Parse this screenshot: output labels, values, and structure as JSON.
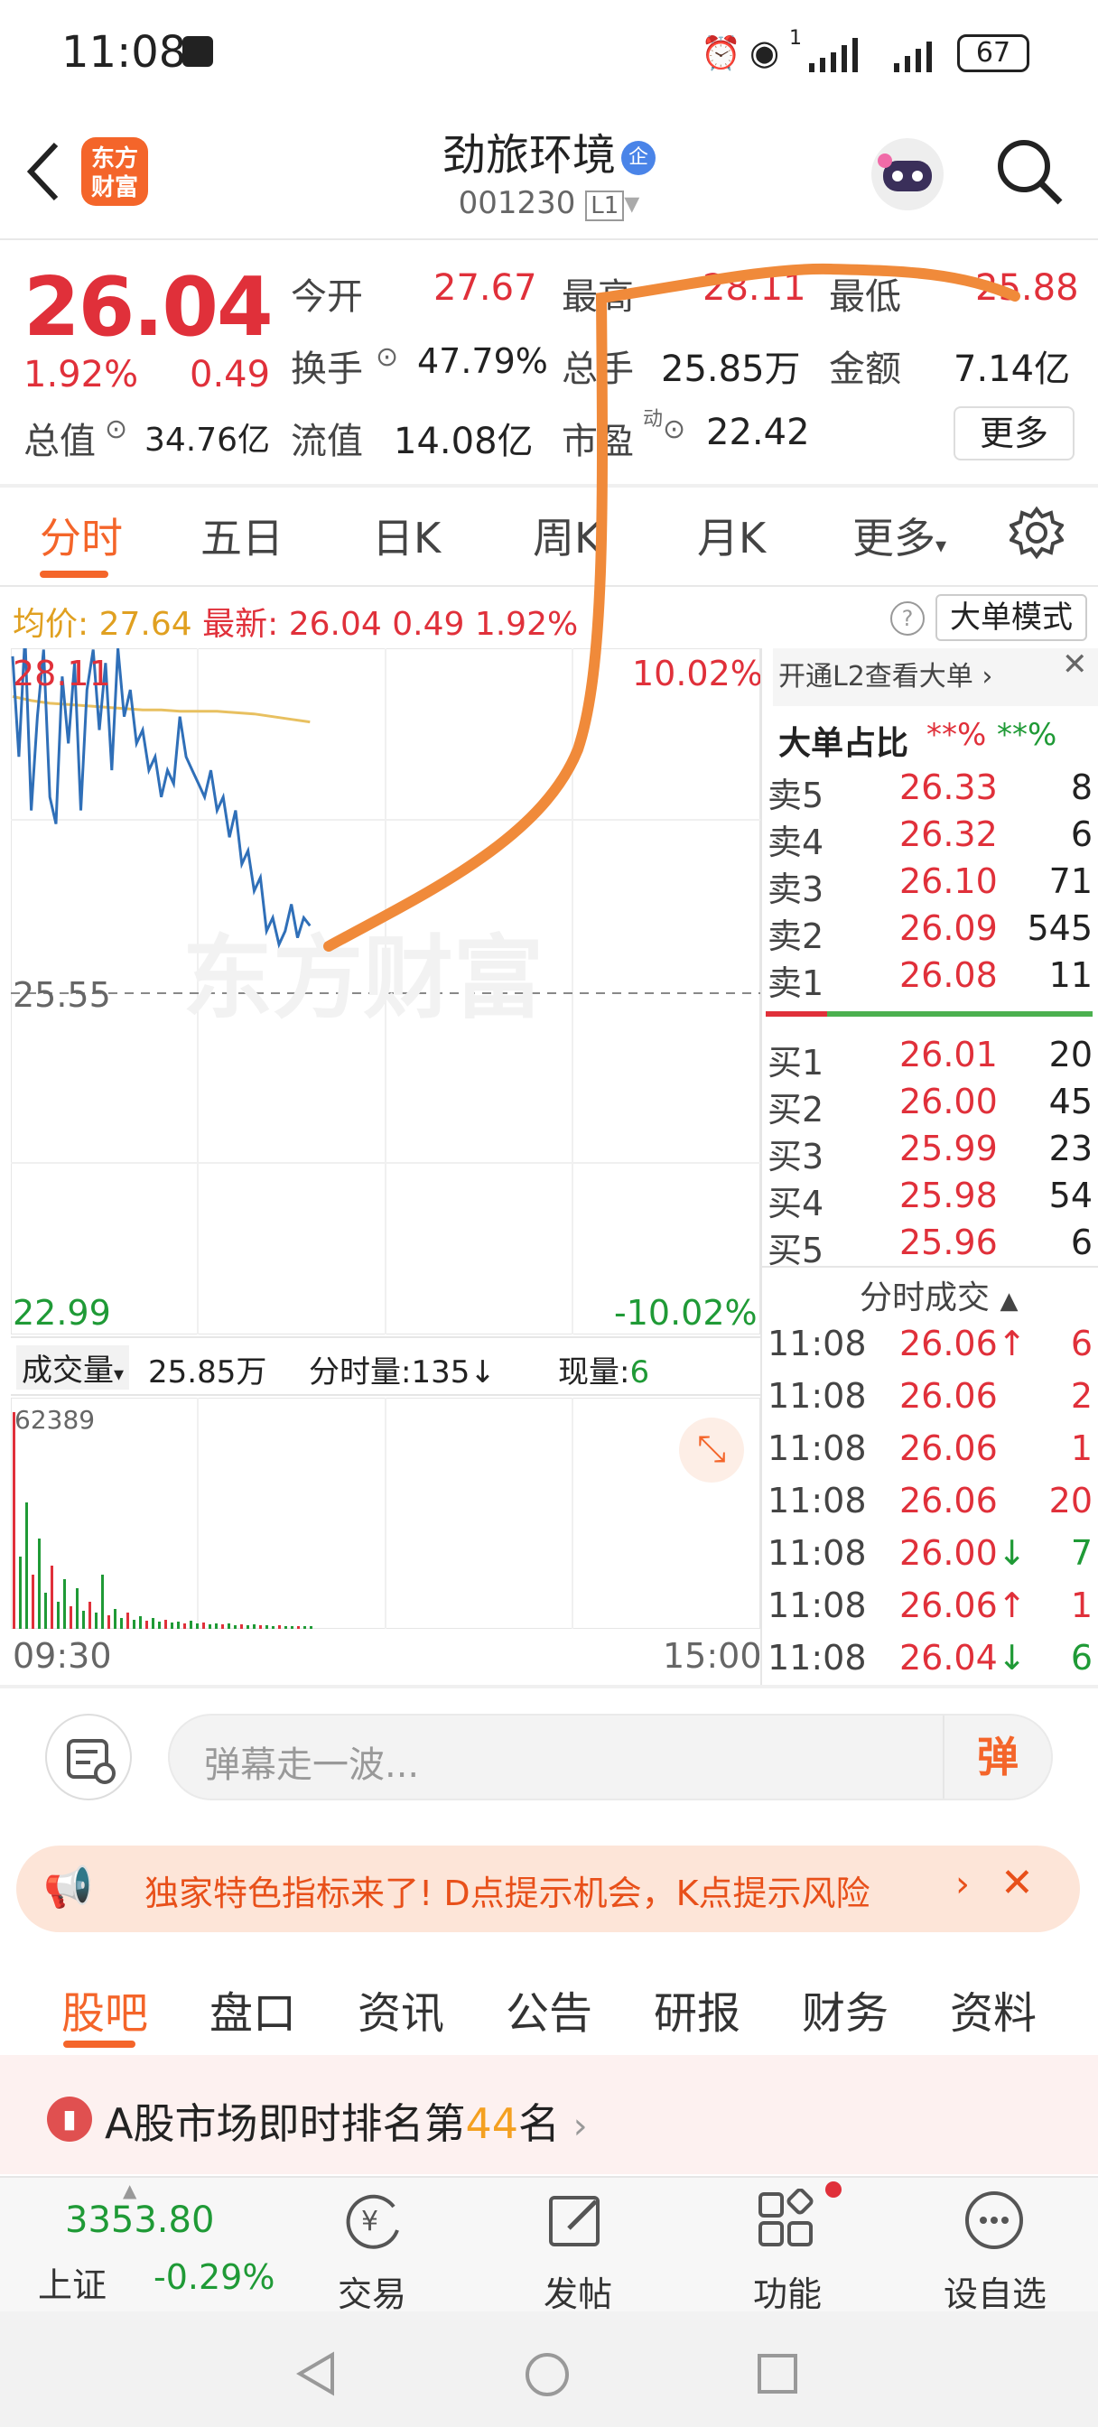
{
  "status_bar": {
    "time": "11:08",
    "battery": "67",
    "signal_label": "1"
  },
  "header": {
    "logo_text_1": "东方",
    "logo_text_2": "财富",
    "title": "劲旅环境",
    "title_badge": "企",
    "code": "001230",
    "level": "L1"
  },
  "quote": {
    "price": "26.04",
    "change_pct": "1.92%",
    "change": "0.49",
    "open_label": "今开",
    "open": "27.67",
    "high_label": "最高",
    "high": "28.11",
    "low_label": "最低",
    "low": "25.88",
    "turnover_label": "换手",
    "turnover": "47.79%",
    "volume_label": "总手",
    "volume": "25.85万",
    "amount_label": "金额",
    "amount": "7.14亿",
    "mktcap_label": "总值",
    "mktcap": "34.76亿",
    "float_label": "流值",
    "float": "14.08亿",
    "pe_label": "市盈",
    "pe_sup": "动",
    "pe": "22.42",
    "more_button": "更多"
  },
  "tabs": [
    "分时",
    "五日",
    "日K",
    "周K",
    "月K",
    "更多"
  ],
  "info_row": {
    "avg_label": "均价:",
    "avg": "27.64",
    "latest_label": "最新:",
    "latest": "26.04",
    "change": "0.49",
    "change_pct": "1.92%",
    "help": "?",
    "big_order_mode": "大单模式"
  },
  "chart_data": {
    "type": "line",
    "y_top": "28.11",
    "y_mid": "25.55",
    "y_bottom": "22.99",
    "pct_top": "10.02%",
    "pct_bottom": "-10.02%",
    "x_start": "09:30",
    "x_end": "15:00",
    "watermark": "东方财富",
    "volume_label": "成交量",
    "volume_total": "25.85万",
    "minute_volume_label": "分时量:",
    "minute_volume": "135",
    "current_label": "现量:",
    "current": "6",
    "volume_max": "62389",
    "series": [
      {
        "values": [
          28.05,
          27.3,
          28.2,
          26.9,
          27.6,
          28.1,
          27.0,
          26.8,
          27.9,
          27.4,
          28.0,
          26.9,
          27.8,
          28.1,
          27.5,
          28.0,
          27.2,
          28.11,
          27.6,
          27.8,
          27.4,
          27.5,
          27.2,
          27.3,
          27.0,
          27.2,
          27.1,
          27.6,
          27.3,
          27.2,
          27.1,
          27.0,
          27.2,
          26.9,
          27.0,
          26.7,
          26.9,
          26.5,
          26.6,
          26.3,
          26.4,
          26.0,
          26.1,
          25.9,
          26.0,
          26.2,
          25.95,
          26.1,
          26.04
        ]
      },
      {
        "values": [
          27.75,
          27.72,
          27.7,
          27.69,
          27.68,
          27.67,
          27.66,
          27.65,
          27.65,
          27.64,
          27.64,
          27.64,
          27.63,
          27.62,
          27.6,
          27.58,
          27.56
        ]
      }
    ]
  },
  "order_book": {
    "header": "开通L2查看大单",
    "ratio_label": "大单占比",
    "ratio_red": "**%",
    "ratio_green": "**%",
    "asks": [
      {
        "label": "卖5",
        "price": "26.33",
        "vol": "8"
      },
      {
        "label": "卖4",
        "price": "26.32",
        "vol": "6"
      },
      {
        "label": "卖3",
        "price": "26.10",
        "vol": "71"
      },
      {
        "label": "卖2",
        "price": "26.09",
        "vol": "545"
      },
      {
        "label": "卖1",
        "price": "26.08",
        "vol": "11"
      }
    ],
    "bids": [
      {
        "label": "买1",
        "price": "26.01",
        "vol": "20"
      },
      {
        "label": "买2",
        "price": "26.00",
        "vol": "45"
      },
      {
        "label": "买3",
        "price": "25.99",
        "vol": "23"
      },
      {
        "label": "买4",
        "price": "25.98",
        "vol": "54"
      },
      {
        "label": "买5",
        "price": "25.96",
        "vol": "6"
      }
    ],
    "ticks_label": "分时成交",
    "ticks": [
      {
        "time": "11:08",
        "price": "26.06",
        "vol": "6",
        "dir": "up"
      },
      {
        "time": "11:08",
        "price": "26.06",
        "vol": "2",
        "dir": ""
      },
      {
        "time": "11:08",
        "price": "26.06",
        "vol": "1",
        "dir": ""
      },
      {
        "time": "11:08",
        "price": "26.06",
        "vol": "20",
        "dir": ""
      },
      {
        "time": "11:08",
        "price": "26.00",
        "vol": "7",
        "dir": "down"
      },
      {
        "time": "11:08",
        "price": "26.06",
        "vol": "1",
        "dir": "up"
      },
      {
        "time": "11:08",
        "price": "26.04",
        "vol": "6",
        "dir": "down"
      }
    ]
  },
  "danmu": {
    "placeholder": "弹幕走一波...",
    "send": "弹"
  },
  "banner": {
    "text": "独家特色指标来了! D点提示机会，K点提示风险"
  },
  "bottom_tabs": [
    "股吧",
    "盘口",
    "资讯",
    "公告",
    "研报",
    "财务",
    "资料"
  ],
  "rank": {
    "prefix": "A股市场即时排名第",
    "rank": "44",
    "suffix": "名"
  },
  "index": {
    "value": "3353.80",
    "name": "上证",
    "change": "-0.29%"
  },
  "nav": [
    "交易",
    "发帖",
    "功能",
    "设自选"
  ]
}
